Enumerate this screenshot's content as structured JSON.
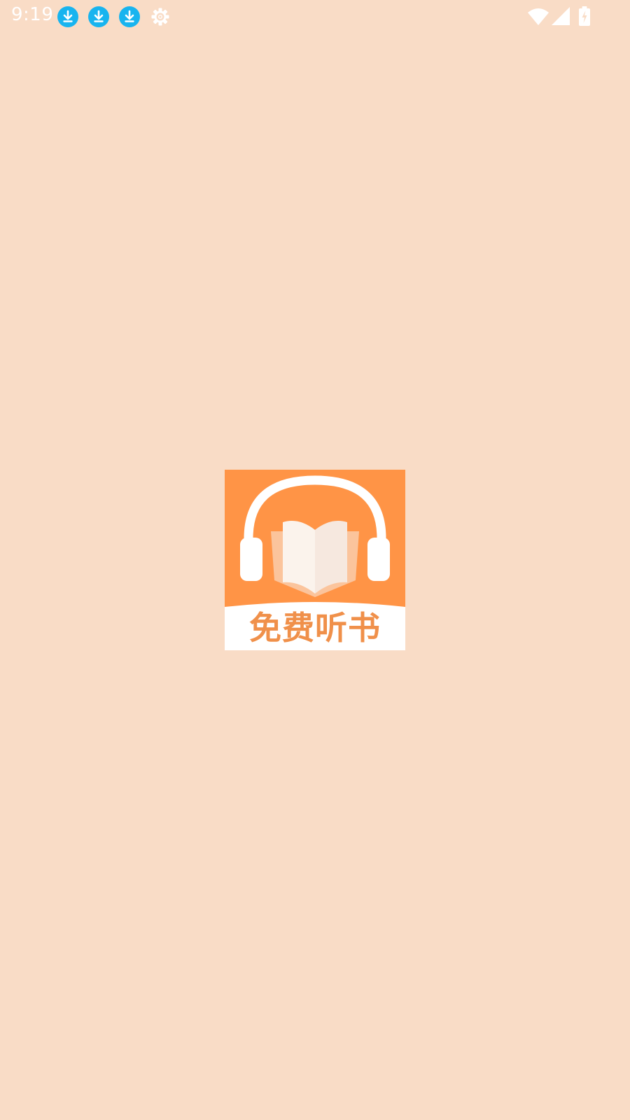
{
  "status_bar": {
    "time": "9:19",
    "notification_icons": [
      "download-icon",
      "download-icon",
      "download-icon",
      "settings-gear-icon"
    ],
    "system_icons": [
      "wifi-icon",
      "cellular-signal-icon",
      "battery-charging-icon"
    ],
    "colors": {
      "text": "#ffffff",
      "download_badge": "#18b4ef"
    }
  },
  "splash": {
    "logo_text": "免费听书",
    "logo_icon": "headphones-book-icon",
    "colors": {
      "background": "#f9dcc6",
      "logo_orange": "#ff9446",
      "logo_text": "#f0904a",
      "logo_white": "#ffffff"
    }
  }
}
